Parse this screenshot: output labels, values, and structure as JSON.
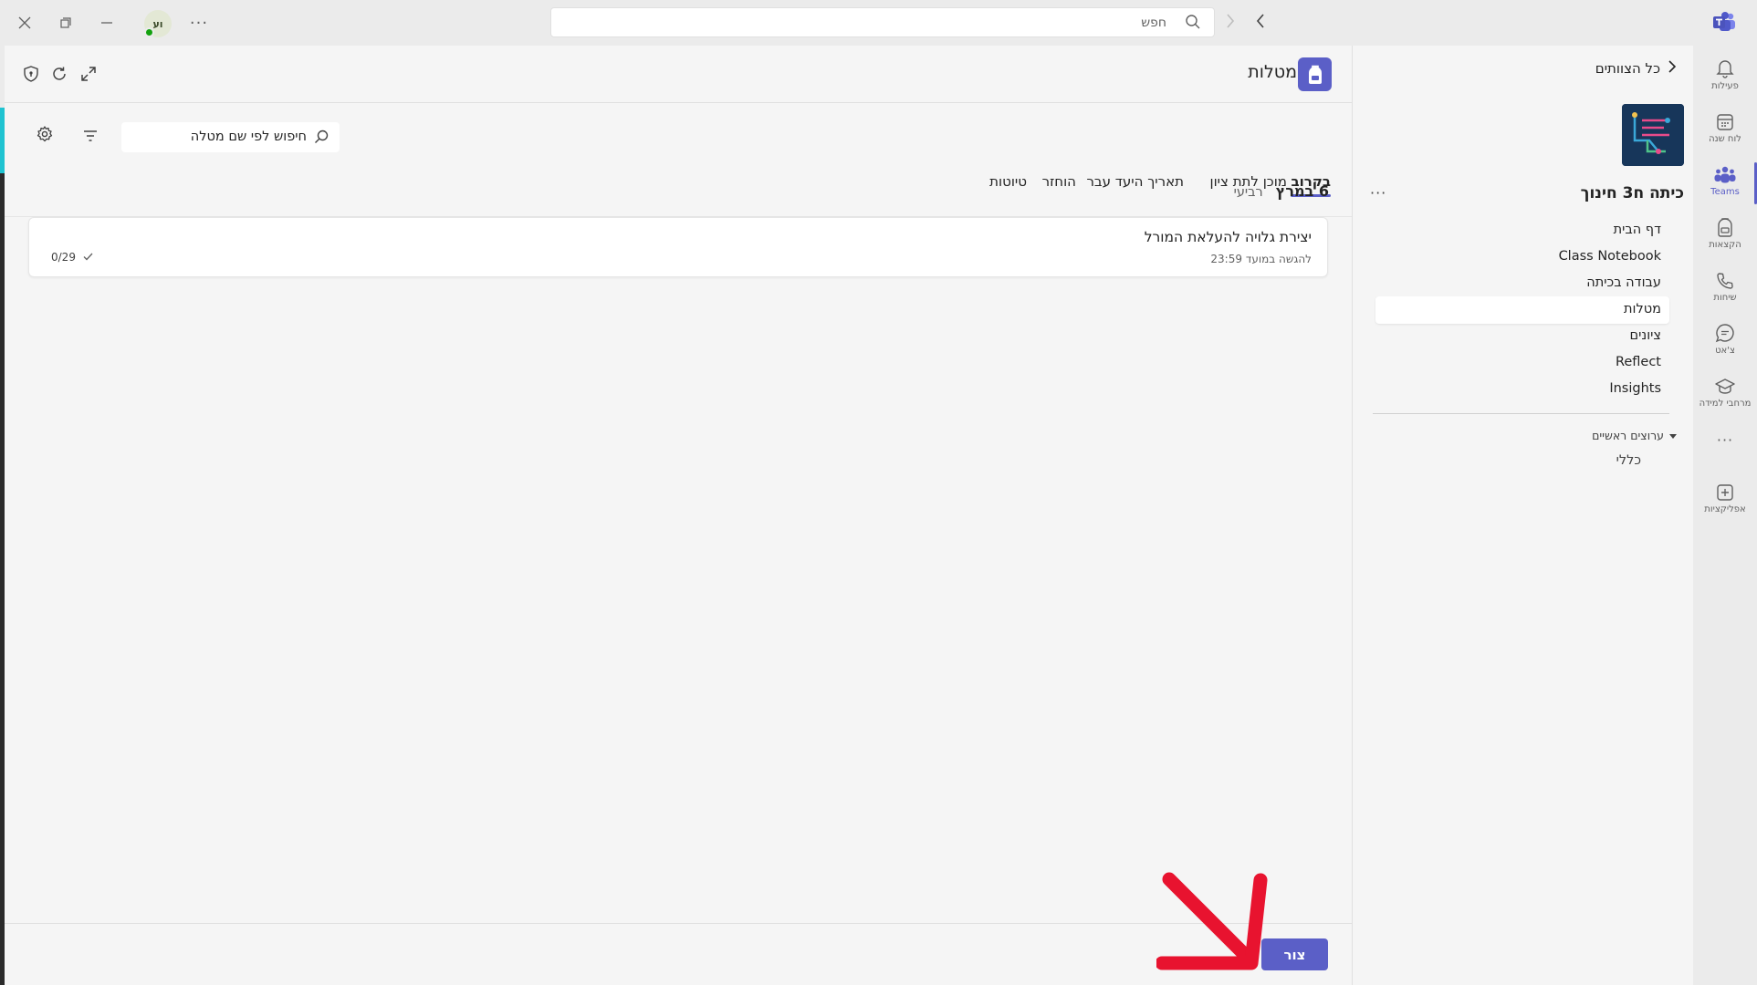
{
  "titlebar": {
    "search_placeholder": "חפש",
    "avatar_initials": "וע",
    "more": "···"
  },
  "app_rail": {
    "items": [
      {
        "label": "פעילות",
        "icon": "bell-icon"
      },
      {
        "label": "לוח שנה",
        "icon": "calendar-icon"
      },
      {
        "label": "Teams",
        "icon": "teams-icon"
      },
      {
        "label": "הקצאות",
        "icon": "backpack-icon"
      },
      {
        "label": "שיחות",
        "icon": "phone-icon"
      },
      {
        "label": "צ'אט",
        "icon": "chat-icon"
      },
      {
        "label": "מרחבי למידה",
        "icon": "graduation-cap-icon"
      },
      {
        "label": "···",
        "icon": "more-icon"
      },
      {
        "label": "אפליקציות",
        "icon": "add-apps-icon"
      }
    ]
  },
  "team_panel": {
    "back_label": "כל הצוותים",
    "team_name": "כיתה ח3 חינוך",
    "more": "···",
    "channels": [
      "דף הבית",
      "Class Notebook",
      "עבודה בכיתה",
      "מטלות",
      "ציונים",
      "Reflect",
      "Insights"
    ],
    "main_channels_header": "ערוצים ראשיים",
    "general_channel": "כללי"
  },
  "main": {
    "title": "מטלות",
    "tabs": [
      {
        "label": "בקרוב",
        "active": true
      },
      {
        "label": "מוכן לתת ציון",
        "active": false
      },
      {
        "label": "תאריך היעד עבר",
        "active": false
      },
      {
        "label": "הוחזר",
        "active": false
      },
      {
        "label": "טיוטות",
        "active": false
      }
    ],
    "search_placeholder": "חיפוש לפי שם מטלה",
    "date_header": "6 במרץ",
    "weekday": "רביעי",
    "assignment": {
      "title": "יצירת גלויה להעלאת המורל",
      "due": "להגשה במועד 23:59",
      "count": "0/29"
    },
    "create_button": "צור"
  },
  "colors": {
    "accent": "#5b5fc7",
    "annotation_arrow": "#e8132f"
  }
}
